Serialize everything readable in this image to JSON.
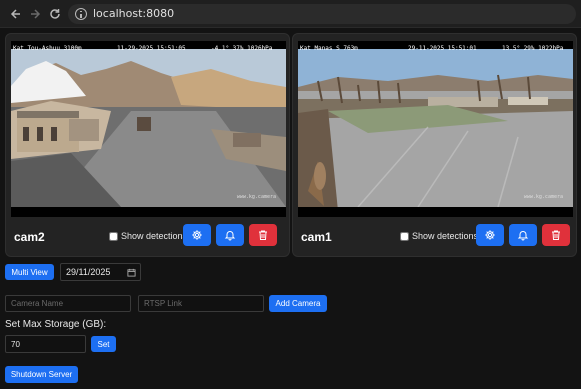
{
  "browser": {
    "url": "localhost:8080",
    "back_icon": "arrow-left-icon",
    "forward_icon": "arrow-right-icon",
    "reload_icon": "reload-icon",
    "info_icon": "info-icon"
  },
  "cameras": [
    {
      "name": "cam2",
      "osd_left": "Kat Tou-Ashuu 3100m",
      "osd_date": "11-29-2025 15:51:05",
      "osd_right": "-4.1° 37% 1026hPa",
      "watermark": "www.kg.camera",
      "detections_label": "Show detections",
      "detections_checked": false
    },
    {
      "name": "cam1",
      "osd_left": "Kat Manas S 763m",
      "osd_date": "29-11-2025 15:51:01",
      "osd_right": "13.5° 29% 1022hPa",
      "watermark": "www.kg.camera",
      "detections_label": "Show detections",
      "detections_checked": false
    }
  ],
  "controls": {
    "multi_view_label": "Multi View",
    "date_value": "29/11/2025",
    "camera_name_placeholder": "Camera Name",
    "rtsp_placeholder": "RTSP Link",
    "add_camera_label": "Add Camera",
    "storage_label": "Set Max Storage (GB):",
    "storage_value": "70",
    "set_label": "Set",
    "shutdown_label": "Shutdown Server"
  },
  "colors": {
    "accent": "#1d6ff2",
    "danger": "#e0313b",
    "background": "#131313",
    "card": "#232323"
  }
}
